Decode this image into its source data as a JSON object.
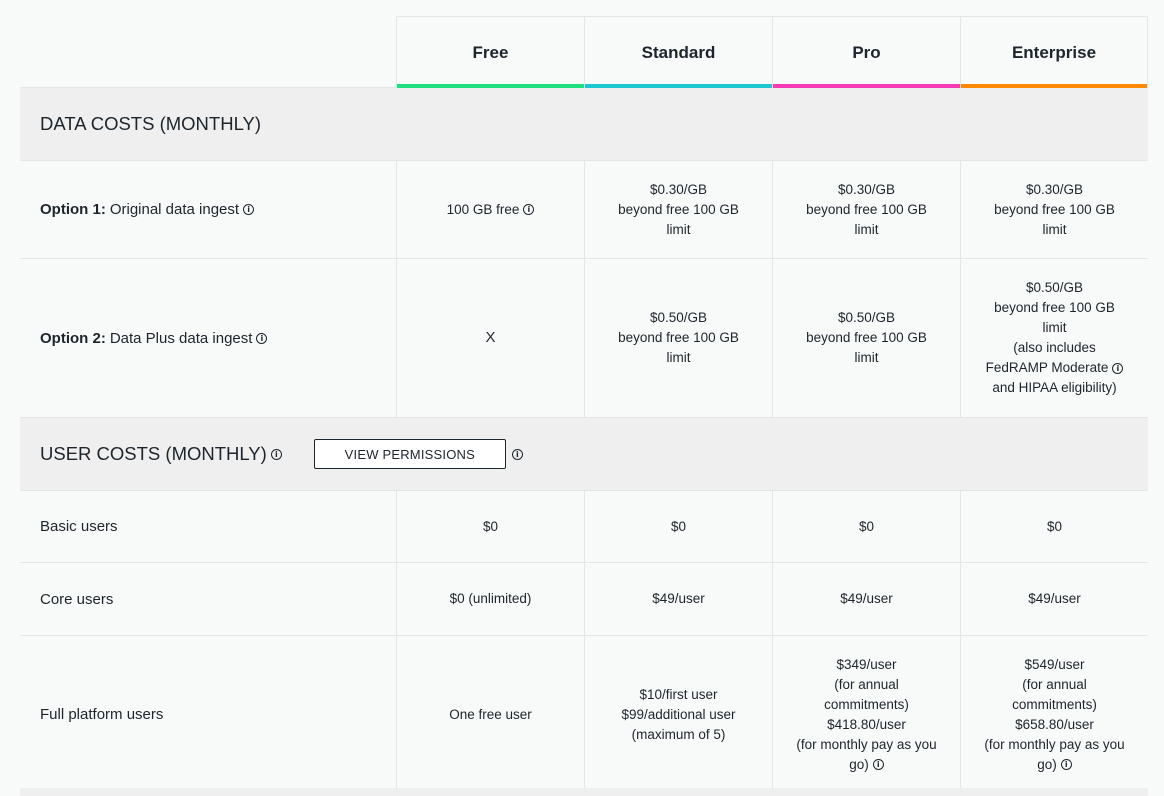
{
  "plans": [
    {
      "name": "Free",
      "color": "#1ee07f"
    },
    {
      "name": "Standard",
      "color": "#1cc7d0"
    },
    {
      "name": "Pro",
      "color": "#f53cb4"
    },
    {
      "name": "Enterprise",
      "color": "#ff8a00"
    }
  ],
  "data_costs": {
    "title": "DATA COSTS (MONTHLY)",
    "option1": {
      "bold": "Option 1:",
      "label": "Original data ingest",
      "free": "100 GB free",
      "standard": [
        "$0.30/GB",
        "beyond free 100 GB",
        "limit"
      ],
      "pro": [
        "$0.30/GB",
        "beyond free 100 GB",
        "limit"
      ],
      "enterprise": [
        "$0.30/GB",
        "beyond free 100 GB",
        "limit"
      ]
    },
    "option2": {
      "bold": "Option 2:",
      "label": "Data Plus data ingest",
      "free": "X",
      "standard": [
        "$0.50/GB",
        "beyond free 100 GB",
        "limit"
      ],
      "pro": [
        "$0.50/GB",
        "beyond free 100 GB",
        "limit"
      ],
      "enterprise": [
        "$0.50/GB",
        "beyond free 100 GB",
        "limit",
        "(also includes",
        "FedRAMP Moderate",
        "and HIPAA eligibility)"
      ]
    }
  },
  "user_costs": {
    "title": "USER COSTS (MONTHLY)",
    "view_permissions": "VIEW PERMISSIONS",
    "basic": {
      "label": "Basic users",
      "free": "$0",
      "standard": "$0",
      "pro": "$0",
      "enterprise": "$0"
    },
    "core": {
      "label": "Core users",
      "free": "$0 (unlimited)",
      "standard": "$49/user",
      "pro": "$49/user",
      "enterprise": "$49/user"
    },
    "full": {
      "label": "Full platform users",
      "free": "One free user",
      "standard": [
        "$10/first user",
        "$99/additional user",
        "(maximum of 5)"
      ],
      "pro": [
        "$349/user",
        "(for annual",
        "commitments)",
        "$418.80/user",
        "(for monthly pay as you",
        "go)"
      ],
      "enterprise": [
        "$549/user",
        "(for annual",
        "commitments)",
        "$658.80/user",
        "(for monthly pay as you",
        "go)"
      ]
    }
  },
  "info_icon": "info-icon"
}
